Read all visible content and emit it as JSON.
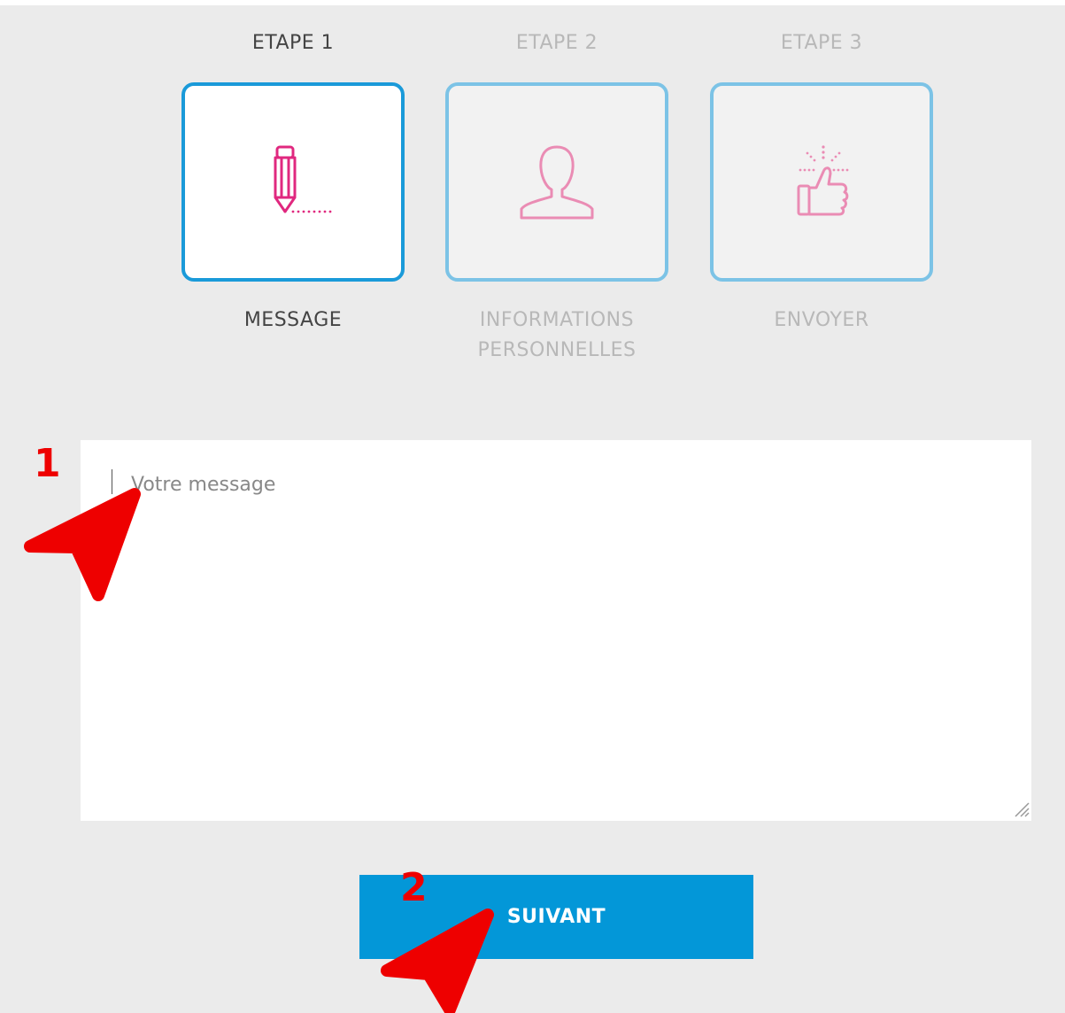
{
  "steps": [
    {
      "label": "ETAPE 1",
      "name": "MESSAGE",
      "icon": "pencil-icon",
      "active": true
    },
    {
      "label": "ETAPE 2",
      "name": "INFORMATIONS\nPERSONNELLES",
      "icon": "user-icon",
      "active": false
    },
    {
      "label": "ETAPE 3",
      "name": "ENVOYER",
      "icon": "thumbs-up-icon",
      "active": false
    }
  ],
  "form": {
    "message_placeholder": "Votre message",
    "message_value": "",
    "next_label": "SUIVANT"
  },
  "annotations": [
    {
      "number": "1",
      "target": "message-textarea"
    },
    {
      "number": "2",
      "target": "next-button"
    }
  ],
  "colors": {
    "accent": "#0397d8",
    "active_border": "#1a9ad9",
    "inactive_border": "#7cc3e6",
    "icon_active": "#e0287f",
    "icon_inactive": "#ea8cb4",
    "annotation": "#ee0000",
    "background": "#ebebeb"
  }
}
